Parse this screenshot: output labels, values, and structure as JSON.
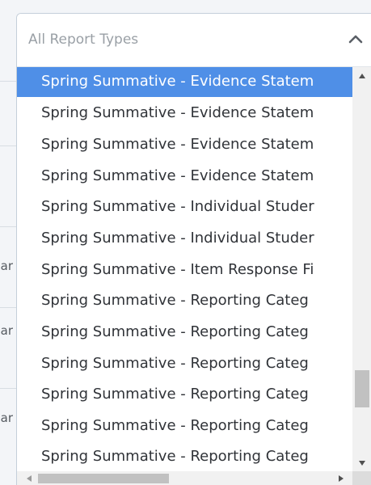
{
  "background": {
    "row_snippets": [
      "ar",
      "ar",
      "ar"
    ]
  },
  "dropdown": {
    "placeholder": "All Report Types",
    "toggle_icon": "chevron-up-icon",
    "selected_color": "#4f8fe7",
    "options": [
      {
        "label": "Spring Summative - Evidence Statem",
        "selected": true
      },
      {
        "label": "Spring Summative - Evidence Statem",
        "selected": false
      },
      {
        "label": "Spring Summative - Evidence Statem",
        "selected": false
      },
      {
        "label": "Spring Summative - Evidence Statem",
        "selected": false
      },
      {
        "label": "Spring Summative - Individual Studer",
        "selected": false
      },
      {
        "label": "Spring Summative - Individual Studer",
        "selected": false
      },
      {
        "label": "Spring Summative - Item Response Fi",
        "selected": false
      },
      {
        "label": "Spring Summative - Reporting Categ",
        "selected": false
      },
      {
        "label": "Spring Summative - Reporting Categ",
        "selected": false
      },
      {
        "label": "Spring Summative - Reporting Categ",
        "selected": false
      },
      {
        "label": "Spring Summative - Reporting Categ",
        "selected": false
      },
      {
        "label": "Spring Summative - Reporting Categ",
        "selected": false
      },
      {
        "label": "Spring Summative - Reporting Categ",
        "selected": false
      }
    ]
  }
}
